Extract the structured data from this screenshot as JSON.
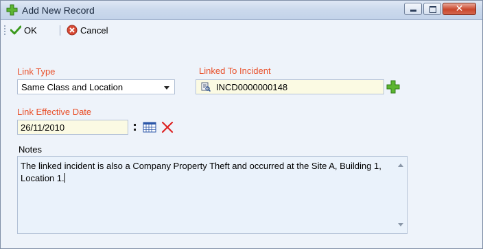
{
  "window": {
    "title": "Add New Record"
  },
  "toolbar": {
    "ok_label": "OK",
    "cancel_label": "Cancel"
  },
  "form": {
    "link_type": {
      "label": "Link Type",
      "value": "Same Class and Location"
    },
    "linked_incident": {
      "label": "Linked To Incident",
      "value": "INCD0000000148"
    },
    "effective_date": {
      "label": "Link Effective Date",
      "value": "26/11/2010"
    },
    "notes": {
      "label": "Notes",
      "value": "The linked incident is also a Company Property Theft and occurred at the Site A, Building 1, Location 1."
    }
  },
  "colors": {
    "required_label": "#e9502a",
    "highlight_field": "#fbfae3",
    "add_icon": "#5cb531",
    "close_button": "#c9462c"
  },
  "icons": [
    "add-plus-icon",
    "minimize-icon",
    "maximize-icon",
    "close-icon",
    "checkmark-icon",
    "cancel-icon",
    "lookup-icon",
    "calendar-icon",
    "clear-x-icon"
  ]
}
